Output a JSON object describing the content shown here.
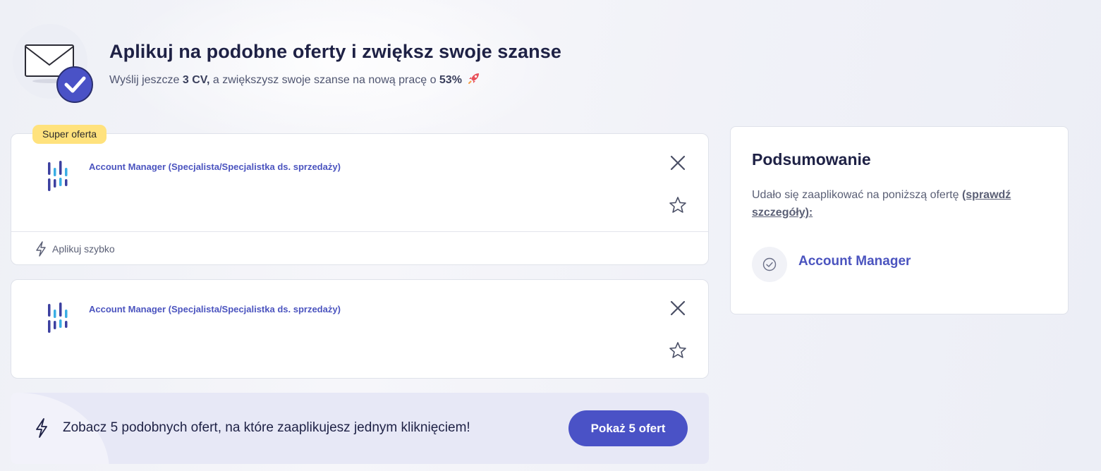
{
  "hero": {
    "title": "Aplikuj na podobne oferty i zwiększ swoje szanse",
    "subtitle_prefix": "Wyślij jeszcze ",
    "subtitle_cv": "3 CV,",
    "subtitle_middle": " a zwiększysz swoje szanse na nową pracę o ",
    "subtitle_percent": "53%",
    "icon": "envelope-check-icon"
  },
  "offers": [
    {
      "badge": "Super oferta",
      "title": "Account Manager (Specjalista/Specjalistka ds. sprzedaży)",
      "quick_apply_label": "Aplikuj szybko"
    },
    {
      "title": "Account Manager (Specjalista/Specjalistka ds. sprzedaży)"
    }
  ],
  "promo": {
    "text": "Zobacz 5 podobnych ofert, na które zaaplikujesz jednym kliknięciem!",
    "button_label": "Pokaż 5 ofert"
  },
  "summary": {
    "title": "Podsumowanie",
    "description": "Udało się zaaplikować na poniższą ofertę ",
    "details_link": "(sprawdź szczegóły):",
    "applied_offer_title": "Account Manager"
  },
  "colors": {
    "accent": "#4a52c6",
    "link": "#4b54bf",
    "badge": "#ffe27d",
    "heading": "#1e2145"
  }
}
